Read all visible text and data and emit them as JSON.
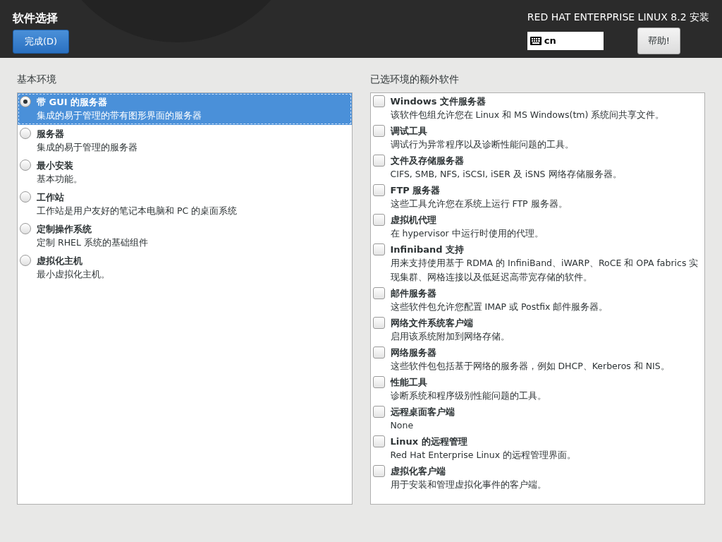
{
  "header": {
    "title": "软件选择",
    "done_button": "完成(D)",
    "product": "RED HAT ENTERPRISE LINUX 8.2 安装",
    "keyboard_layout": "cn",
    "help_button": "帮助!"
  },
  "base_environment": {
    "heading": "基本环境",
    "items": [
      {
        "name": "带 GUI 的服务器",
        "description": "集成的易于管理的带有图形界面的服务器",
        "selected": true
      },
      {
        "name": "服务器",
        "description": "集成的易于管理的服务器",
        "selected": false
      },
      {
        "name": "最小安装",
        "description": "基本功能。",
        "selected": false
      },
      {
        "name": "工作站",
        "description": "工作站是用户友好的笔记本电脑和 PC 的桌面系统",
        "selected": false
      },
      {
        "name": "定制操作系统",
        "description": "定制 RHEL 系统的基础组件",
        "selected": false
      },
      {
        "name": "虚拟化主机",
        "description": "最小虚拟化主机。",
        "selected": false
      }
    ]
  },
  "addons": {
    "heading": "已选环境的额外软件",
    "items": [
      {
        "name": "Windows 文件服务器",
        "description": "该软件包组允许您在 Linux 和 MS Windows(tm) 系统间共享文件。",
        "checked": false
      },
      {
        "name": "调试工具",
        "description": "调试行为异常程序以及诊断性能问题的工具。",
        "checked": false
      },
      {
        "name": "文件及存储服务器",
        "description": "CIFS, SMB, NFS, iSCSI, iSER 及 iSNS 网络存储服务器。",
        "checked": false
      },
      {
        "name": "FTP 服务器",
        "description": "这些工具允许您在系统上运行 FTP 服务器。",
        "checked": false
      },
      {
        "name": "虚拟机代理",
        "description": "在 hypervisor 中运行时使用的代理。",
        "checked": false
      },
      {
        "name": "Infiniband 支持",
        "description": "用来支持使用基于 RDMA 的 InfiniBand、iWARP、RoCE 和 OPA fabrics 实现集群、网格连接以及低延迟高带宽存储的软件。",
        "checked": false
      },
      {
        "name": "邮件服务器",
        "description": "这些软件包允许您配置 IMAP 或 Postfix 邮件服务器。",
        "checked": false
      },
      {
        "name": "网络文件系统客户端",
        "description": "启用该系统附加到网络存储。",
        "checked": false
      },
      {
        "name": "网络服务器",
        "description": "这些软件包包括基于网络的服务器，例如 DHCP、Kerberos 和 NIS。",
        "checked": false
      },
      {
        "name": "性能工具",
        "description": "诊断系统和程序级别性能问题的工具。",
        "checked": false
      },
      {
        "name": "远程桌面客户端",
        "description": "None",
        "checked": false
      },
      {
        "name": "Linux 的远程管理",
        "description": "Red Hat Enterprise Linux 的远程管理界面。",
        "checked": false
      },
      {
        "name": "虚拟化客户端",
        "description": "用于安装和管理虚拟化事件的客户端。",
        "checked": false
      }
    ]
  }
}
